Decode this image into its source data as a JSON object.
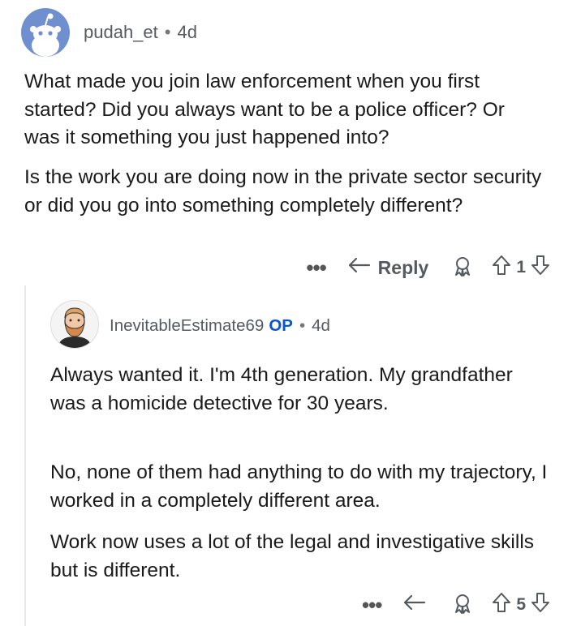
{
  "parent_comment": {
    "username": "pudah_et",
    "separator": "•",
    "age": "4d",
    "paragraphs": [
      "What made you join law enforcement when you first started? Did you always want to be a police officer? Or was it something you just happened into?",
      "Is the work you are doing now in the private sector security or did you go into something completely different?"
    ],
    "actions": {
      "more_label": "•••",
      "reply_label": "Reply",
      "vote_count": "1"
    }
  },
  "reply_comment": {
    "username": "InevitableEstimate69",
    "op_badge": "OP",
    "separator": "•",
    "age": "4d",
    "paragraphs": [
      "Always wanted it. I'm 4th generation. My grandfather was a homicide detective for 30 years.",
      "No, none of them had anything to do with my trajectory, I worked in a completely different area.",
      "Work now uses a lot of the legal and investigative skills but is different."
    ],
    "actions": {
      "more_label": "•••",
      "vote_count": "5"
    }
  },
  "icons": {
    "avatar_parent": "snoo-avatar-icon",
    "avatar_reply": "bearded-man-avatar-icon",
    "reply": "reply-arrow-icon",
    "award": "award-icon",
    "upvote": "upvote-arrow-icon",
    "downvote": "downvote-arrow-icon"
  },
  "colors": {
    "text": "#1a1a1b",
    "meta": "#555a5f",
    "op_badge": "#0a55d4",
    "avatar_bg": "#6f8fce",
    "thread_line": "#e7e7e7"
  }
}
